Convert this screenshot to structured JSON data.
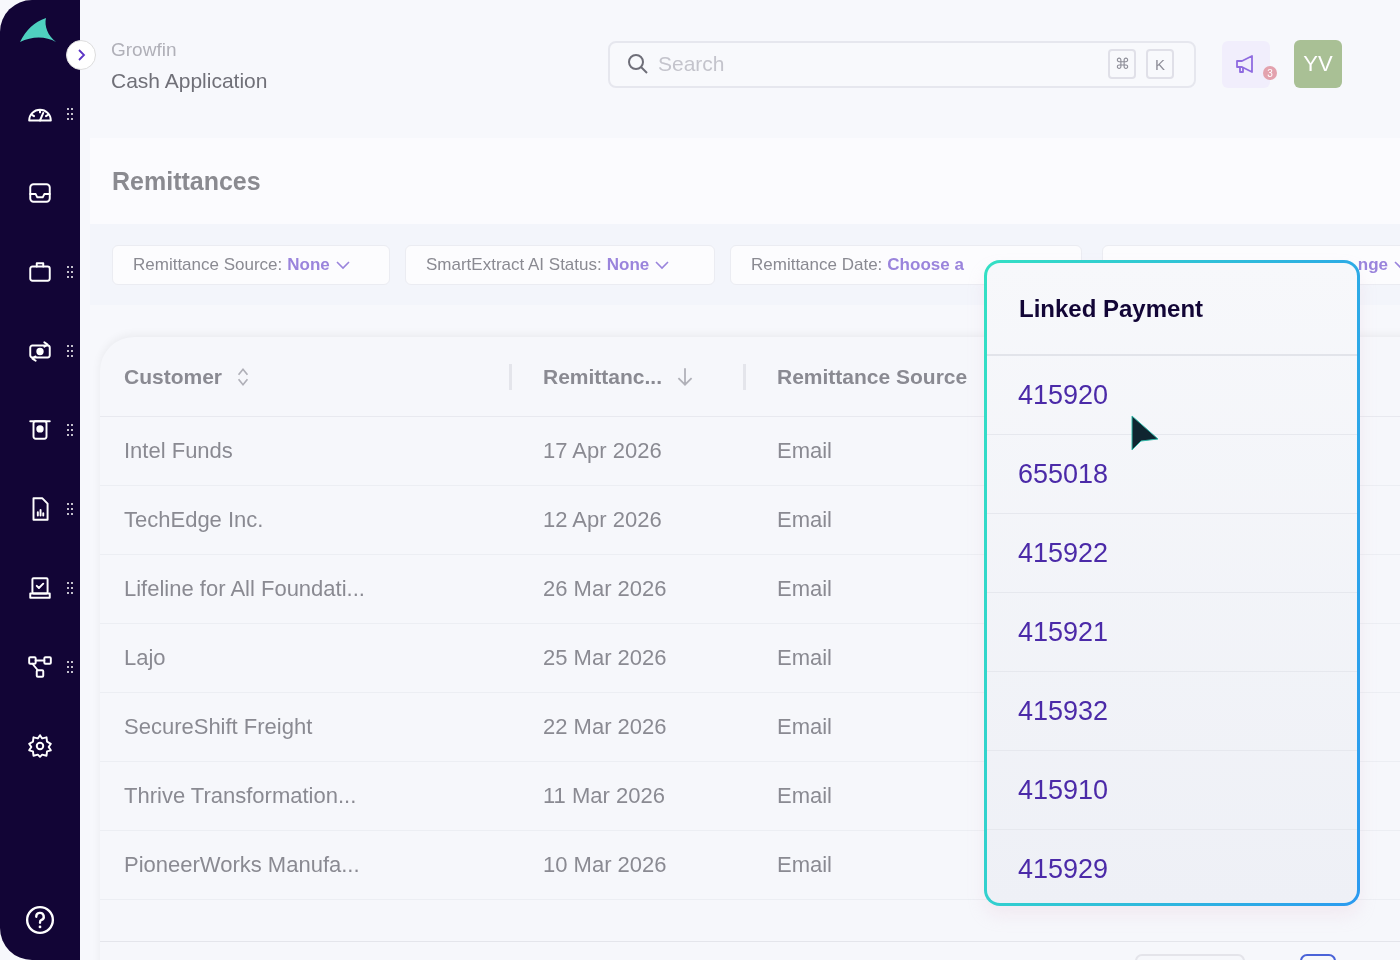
{
  "sidebar": {
    "items": [
      {
        "has_handle": true
      },
      {
        "has_handle": false
      },
      {
        "has_handle": true
      },
      {
        "has_handle": true
      },
      {
        "has_handle": true
      },
      {
        "has_handle": true
      },
      {
        "has_handle": true
      },
      {
        "has_handle": true
      },
      {
        "has_handle": false
      }
    ]
  },
  "header": {
    "org": "Growfin",
    "module": "Cash Application"
  },
  "search": {
    "placeholder": "Search",
    "shortcut_keys": [
      "⌘",
      "K"
    ]
  },
  "notifications": {
    "badge": "3"
  },
  "avatar": {
    "initials": "YV"
  },
  "page_title": "Remittances",
  "filters": [
    {
      "label": "Remittance Source:",
      "value": "None"
    },
    {
      "label": "SmartExtract AI Status:",
      "value": "None"
    },
    {
      "label": "Remittance Date:",
      "value": "Choose a"
    },
    {
      "value": "nge"
    }
  ],
  "table": {
    "columns": [
      {
        "label": "Customer",
        "sortable": true,
        "sorted_descending": false
      },
      {
        "label": "Remittanc...",
        "sortable": true,
        "sorted_descending": true
      },
      {
        "label": "Remittance Source",
        "sortable": false
      }
    ],
    "rows": [
      {
        "customer": "Intel Funds",
        "date": "17 Apr 2026",
        "source": "Email"
      },
      {
        "customer": "TechEdge Inc.",
        "date": "12 Apr 2026",
        "source": "Email"
      },
      {
        "customer": "Lifeline for All Foundati...",
        "date": "26 Mar 2026",
        "source": "Email"
      },
      {
        "customer": "Lajo",
        "date": "25 Mar 2026",
        "source": "Email"
      },
      {
        "customer": "SecureShift Freight",
        "date": "22 Mar 2026",
        "source": "Email"
      },
      {
        "customer": "Thrive Transformation...",
        "date": "11 Mar 2026",
        "source": "Email"
      },
      {
        "customer": "PioneerWorks Manufa...",
        "date": "10 Mar 2026",
        "source": "Email"
      }
    ]
  },
  "popover": {
    "title": "Linked Payment",
    "items": [
      "415920",
      "655018",
      "415922",
      "415921",
      "415932",
      "415910",
      "415929"
    ]
  }
}
